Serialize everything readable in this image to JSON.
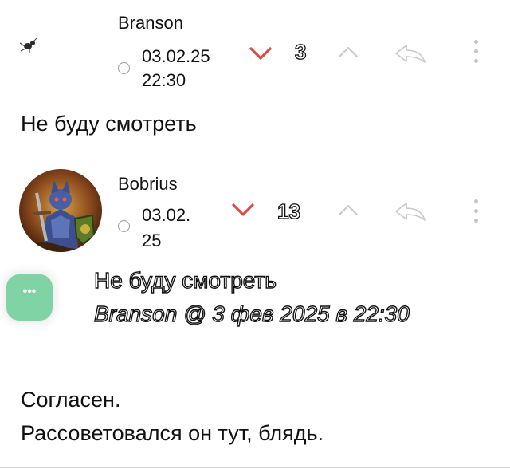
{
  "comments": [
    {
      "author": "Branson",
      "date": "03.02.25",
      "time": "22:30",
      "score": "3",
      "text": "Не буду смотреть",
      "avatar": "bug-avatar-icon"
    },
    {
      "author": "Bobrius",
      "date_part1": "03.02.",
      "date_part2": "25",
      "score": "13",
      "quote_text": "Не буду смотреть",
      "quote_attribution": "Branson @ 3 фев 2025 в 22:30",
      "text_line1": "Согласен.",
      "text_line2": "Рассоветовался он тут, блядь.",
      "avatar": "knight-avatar-image"
    }
  ],
  "fab": {
    "label": "•••"
  },
  "colors": {
    "downvote": "#e04848",
    "upvote": "#c8c8c8",
    "fab": "#7fd3a4",
    "divider": "#cfcfcf"
  }
}
